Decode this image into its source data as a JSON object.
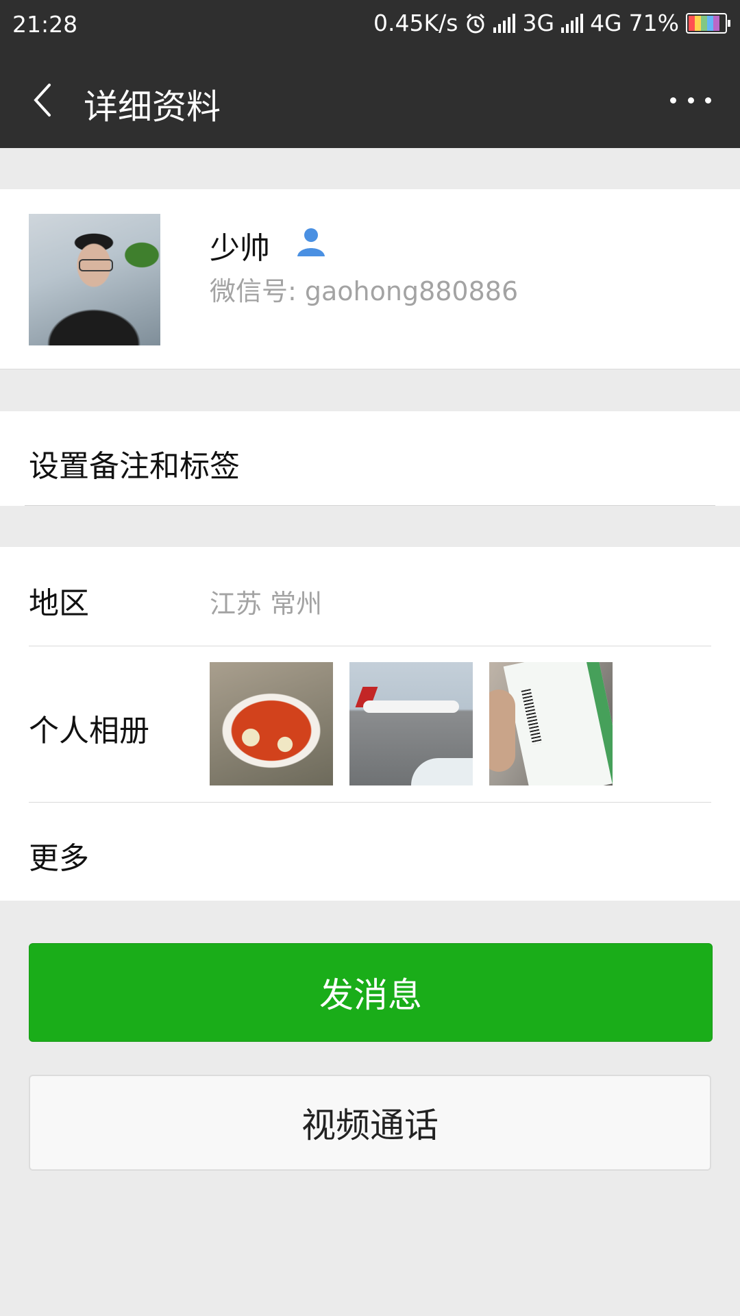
{
  "status_bar": {
    "time": "21:28",
    "net_speed": "0.45K/s",
    "sim1": "3G",
    "sim2": "4G",
    "battery_pct": "71%",
    "icons": [
      "alarm-icon",
      "signal-icon",
      "signal-icon",
      "battery-icon"
    ]
  },
  "nav": {
    "title": "详细资料",
    "back_icon": "chevron-left-icon",
    "more_icon": "more-dots-icon"
  },
  "profile": {
    "name": "少帅",
    "wechat_id": "微信号: gaohong880886",
    "contact_icon": "person-icon",
    "accent_color": "#4a90e2"
  },
  "remark": {
    "label": "设置备注和标签"
  },
  "info": {
    "region_label": "地区",
    "region_value": "江苏  常州",
    "album_label": "个人相册",
    "album_photos": [
      "noodles-photo",
      "airplane-photo",
      "ticket-photo"
    ],
    "more_label": "更多"
  },
  "actions": {
    "send_message": "发消息",
    "video_call": "视频通话",
    "primary_color": "#1aad19"
  }
}
